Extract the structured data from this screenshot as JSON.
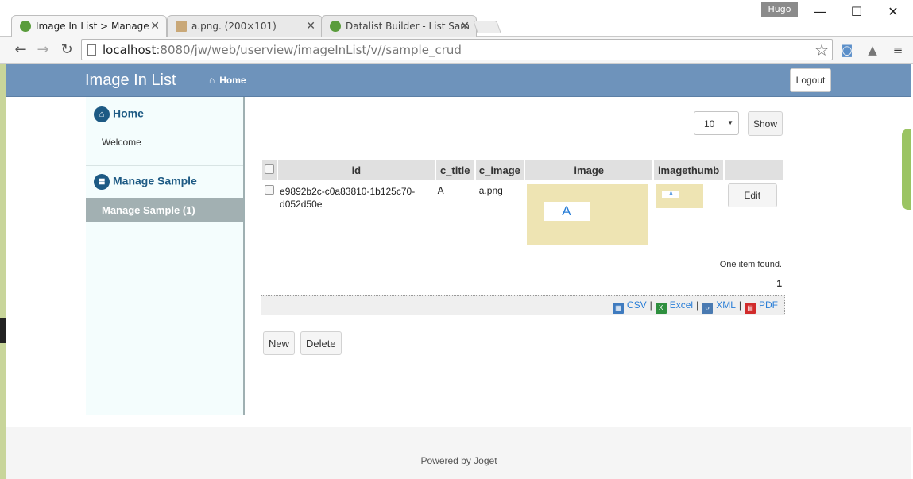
{
  "browser": {
    "tabs": [
      {
        "label": "Image In List  >  Manage"
      },
      {
        "label": "a.png. (200×101)"
      },
      {
        "label": "Datalist Builder - List Sam"
      }
    ],
    "profile_name": "Hugo",
    "window_controls": {
      "minimize": "—",
      "maximize": "☐",
      "close": "✕"
    },
    "url_host": "localhost",
    "url_rest": ":8080/jw/web/userview/imageInList/v//sample_crud"
  },
  "header": {
    "brand": "Image In List",
    "home_link": "Home",
    "logout_label": "Logout"
  },
  "sidebar": {
    "categories": [
      {
        "label": "Home",
        "icon": "home-icon",
        "items": [
          {
            "label": "Welcome"
          }
        ]
      },
      {
        "label": "Manage Sample",
        "icon": "list-icon",
        "items": [
          {
            "label": "Manage Sample (1)",
            "active": true
          }
        ]
      }
    ]
  },
  "list": {
    "page_size": "10",
    "show_label": "Show",
    "columns": [
      "id",
      "c_title",
      "c_image",
      "image",
      "imagethumb"
    ],
    "rows": [
      {
        "id": "e9892b2c-c0a83810-1b125c70-d052d50e",
        "c_title": "A",
        "c_image": "a.png",
        "image_text": "A",
        "thumb_text": "A",
        "edit_label": "Edit"
      }
    ],
    "found_text": "One item found.",
    "current_page": "1",
    "exports": [
      "CSV",
      "Excel",
      "XML",
      "PDF"
    ],
    "new_label": "New",
    "delete_label": "Delete"
  },
  "footer": {
    "text": "Powered by Joget"
  },
  "colors": {
    "header": "#6e93bb",
    "sidebar_bg": "#f4fdfd",
    "sidebar_active": "#a2b0b2",
    "link": "#2a7ed7",
    "image_bg": "#eee4b3"
  }
}
